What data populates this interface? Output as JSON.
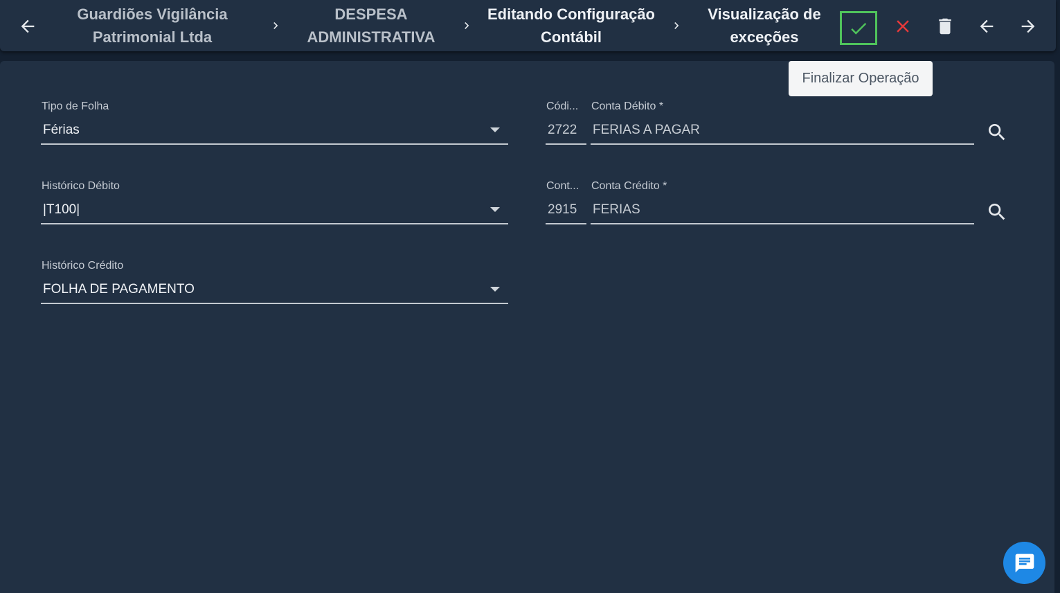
{
  "toolbar": {
    "breadcrumbs": [
      {
        "label": "Guardiões Vigilância\nPatrimonial Ltda"
      },
      {
        "label": "DESPESA\nADMINISTRATIVA"
      },
      {
        "label": "Editando Configuração\nContábil"
      },
      {
        "label": "Visualização de\nexceções"
      }
    ],
    "tooltip": "Finalizar Operação",
    "icons": {
      "back": "arrow-left-icon",
      "separator": "chevron-right-icon",
      "confirm": "check-icon",
      "cancel": "close-icon",
      "delete": "trash-icon",
      "previous": "arrow-left-icon",
      "next": "arrow-right-icon"
    },
    "colors": {
      "confirm": "#4fc35b",
      "cancel": "#e5393a"
    }
  },
  "form": {
    "tipo_folha": {
      "label": "Tipo de Folha",
      "value": "Férias"
    },
    "historico_debito": {
      "label": "Histórico Débito",
      "value": "|T100|"
    },
    "historico_credito": {
      "label": "Histórico Crédito",
      "value": "FOLHA DE PAGAMENTO"
    },
    "codigo_debito": {
      "label": "Códi...",
      "value": "2722"
    },
    "conta_debito": {
      "label": "Conta Débito *",
      "value": "FERIAS A PAGAR"
    },
    "codigo_credito": {
      "label": "Cont...",
      "value": "2915"
    },
    "conta_credito": {
      "label": "Conta Crédito *",
      "value": "FERIAS"
    }
  },
  "chat": {
    "icon": "chat-icon",
    "color": "#1e88e5"
  }
}
